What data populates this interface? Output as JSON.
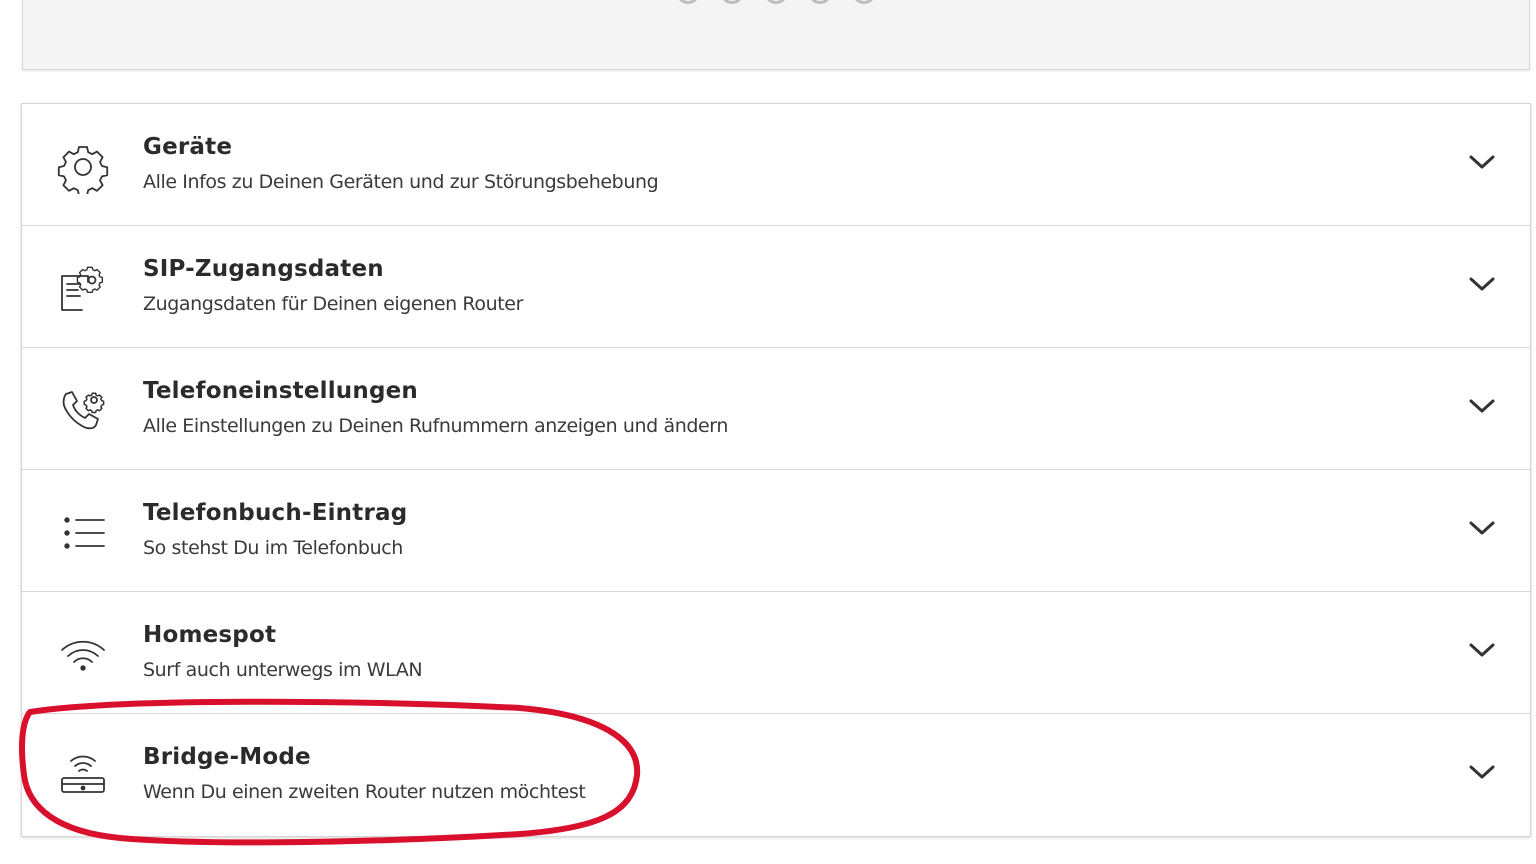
{
  "items": [
    {
      "title": "Geräte",
      "subtitle": "Alle Infos zu Deinen Geräten und zur Störungsbehebung",
      "icon": "gear-icon"
    },
    {
      "title": "SIP-Zugangsdaten",
      "subtitle": "Zugangsdaten für Deinen eigenen Router",
      "icon": "document-settings-icon"
    },
    {
      "title": "Telefoneinstellungen",
      "subtitle": "Alle Einstellungen zu Deinen Rufnummern anzeigen und ändern",
      "icon": "phone-settings-icon"
    },
    {
      "title": "Telefonbuch-Eintrag",
      "subtitle": "So stehst Du im Telefonbuch",
      "icon": "list-icon"
    },
    {
      "title": "Homespot",
      "subtitle": "Surf auch unterwegs im WLAN",
      "icon": "wifi-icon"
    },
    {
      "title": "Bridge-Mode",
      "subtitle": "Wenn Du einen zweiten Router nutzen möchtest",
      "icon": "router-wifi-icon"
    }
  ],
  "colors": {
    "annotation": "#d8102c",
    "icon": "#333333",
    "text": "#2b2b2b"
  }
}
